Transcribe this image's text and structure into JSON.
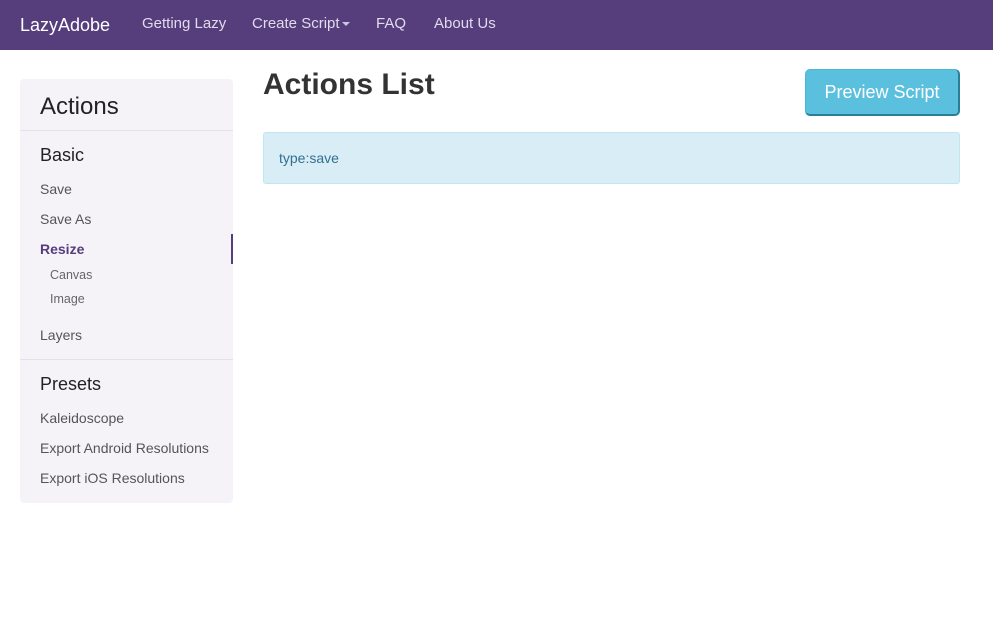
{
  "navbar": {
    "brand": "LazyAdobe",
    "links": [
      "Getting Lazy",
      "Create Script",
      "FAQ",
      "About Us"
    ],
    "bg_color": "#563d7c"
  },
  "sidebar": {
    "title": "Actions",
    "sections": [
      {
        "title": "Basic",
        "items": [
          "Save",
          "Save As",
          "Resize",
          "Layers"
        ],
        "active_item": "Resize",
        "subitems": [
          "Canvas",
          "Image"
        ]
      },
      {
        "title": "Presets",
        "items": [
          "Kaleidoscope",
          "Export Android Resolutions",
          "Export iOS Resolutions"
        ]
      }
    ]
  },
  "main": {
    "title": "Actions List",
    "preview_button": "Preview Script",
    "actions": [
      "type:save"
    ]
  }
}
